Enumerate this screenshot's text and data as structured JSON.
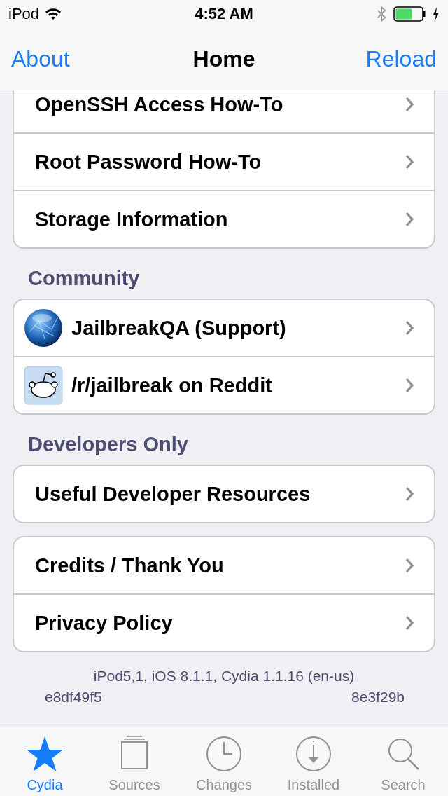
{
  "status_bar": {
    "carrier": "iPod",
    "time": "4:52 AM"
  },
  "nav_bar": {
    "left": "About",
    "title": "Home",
    "right": "Reload"
  },
  "sections": [
    {
      "items": [
        {
          "label": "OpenSSH Access How-To",
          "kind": "plain"
        },
        {
          "label": "Root Password How-To",
          "kind": "plain"
        },
        {
          "label": "Storage Information",
          "kind": "plain"
        }
      ]
    },
    {
      "header": "Community",
      "items": [
        {
          "label": "JailbreakQA (Support)",
          "kind": "globe"
        },
        {
          "label": "/r/jailbreak on Reddit",
          "kind": "robot"
        }
      ]
    },
    {
      "header": "Developers Only",
      "items": [
        {
          "label": "Useful Developer Resources",
          "kind": "plain"
        }
      ]
    },
    {
      "items": [
        {
          "label": "Credits / Thank You",
          "kind": "plain"
        },
        {
          "label": "Privacy Policy",
          "kind": "plain"
        }
      ]
    }
  ],
  "footer": {
    "line_1": "iPod5,1, iOS 8.1.1, Cydia 1.1.16 (en-us)",
    "line_2_left": "e8df49f5",
    "line_2_right": "8e3f29b"
  },
  "tab_bar": [
    {
      "label": "Cydia",
      "selected": true
    },
    {
      "label": "Sources",
      "selected": false
    },
    {
      "label": "Changes",
      "selected": false
    },
    {
      "label": "Installed",
      "selected": false
    },
    {
      "label": "Search",
      "selected": false
    }
  ]
}
